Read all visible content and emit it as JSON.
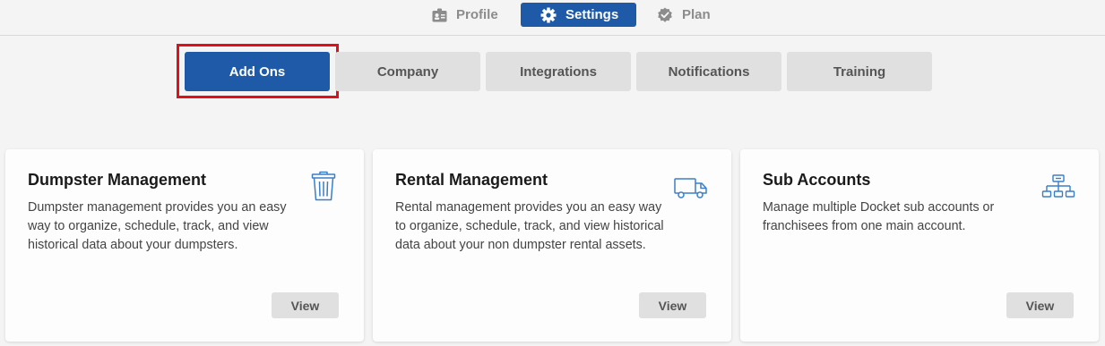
{
  "topnav": {
    "items": [
      {
        "label": "Profile",
        "icon": "id-badge-icon"
      },
      {
        "label": "Settings",
        "icon": "gear-icon"
      },
      {
        "label": "Plan",
        "icon": "check-badge-icon"
      }
    ],
    "active": "Settings",
    "accent_color": "#1e5aa8"
  },
  "subtabs": {
    "items": [
      {
        "label": "Add Ons"
      },
      {
        "label": "Company"
      },
      {
        "label": "Integrations"
      },
      {
        "label": "Notifications"
      },
      {
        "label": "Training"
      }
    ],
    "active": "Add Ons",
    "highlight_color": "#e0101a"
  },
  "cards": [
    {
      "title": "Dumpster Management",
      "description": "Dumpster management provides you an easy way to organize, schedule, track, and view historical data about your dumpsters.",
      "icon": "trash-can-icon",
      "button_label": "View"
    },
    {
      "title": "Rental Management",
      "description": "Rental management provides you an easy way to organize, schedule, track, and view historical data about your non dumpster rental assets.",
      "icon": "truck-icon",
      "button_label": "View"
    },
    {
      "title": "Sub Accounts",
      "description": "Manage multiple Docket sub accounts or franchisees from one main account.",
      "icon": "org-chart-icon",
      "button_label": "View"
    }
  ]
}
